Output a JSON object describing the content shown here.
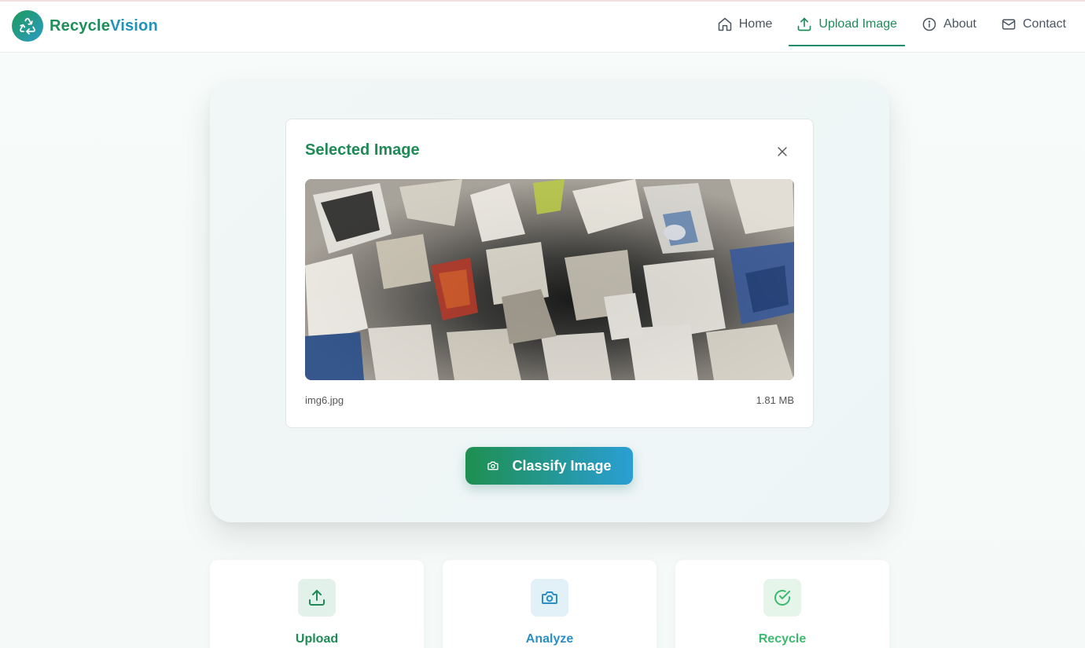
{
  "brand": {
    "name_part1": "Recycle",
    "name_part2": "Vision"
  },
  "nav": {
    "items": [
      {
        "label": "Home",
        "icon": "home-icon"
      },
      {
        "label": "Upload Image",
        "icon": "upload-icon"
      },
      {
        "label": "About",
        "icon": "info-icon"
      },
      {
        "label": "Contact",
        "icon": "mail-icon"
      }
    ]
  },
  "preview": {
    "title": "Selected Image",
    "file_name": "img6.jpg",
    "file_size": "1.81 MB"
  },
  "actions": {
    "classify_label": "Classify Image"
  },
  "steps": [
    {
      "label": "Upload",
      "icon": "upload-icon",
      "color": "#1e8a55",
      "bg": "#e2f2ea"
    },
    {
      "label": "Analyze",
      "icon": "camera-icon",
      "color": "#2a8fc4",
      "bg": "#e2f0f8"
    },
    {
      "label": "Recycle",
      "icon": "check-circle-icon",
      "color": "#3cba6e",
      "bg": "#e6f5ea"
    }
  ],
  "colors": {
    "primary": "#1e8f5a",
    "accent": "#2a9bc4"
  }
}
